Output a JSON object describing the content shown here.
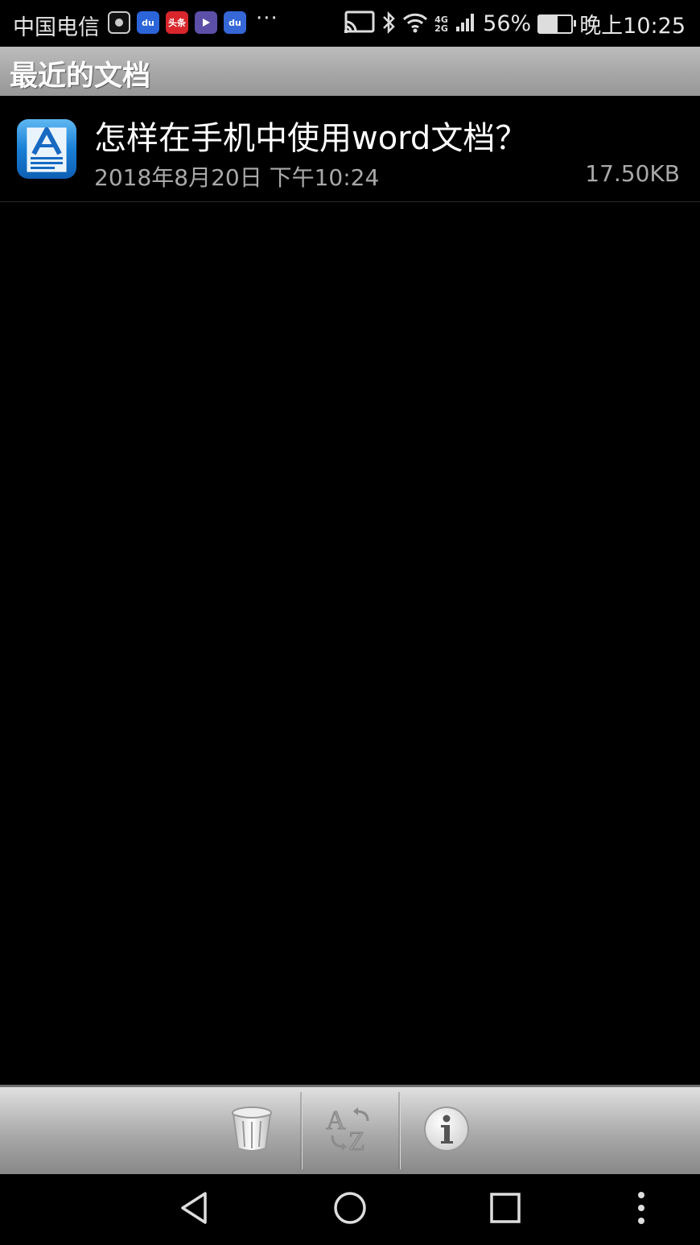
{
  "status_bar": {
    "carrier": "中国电信",
    "apps": [
      {
        "icon": "camera-app-icon",
        "color": "#444"
      },
      {
        "icon": "baidu-app-icon",
        "color": "#2b65d9",
        "text": "du"
      },
      {
        "icon": "toutiao-app-icon",
        "color": "#d8262c",
        "text": "头条"
      },
      {
        "icon": "video-app-icon",
        "color": "#5b4fa8"
      },
      {
        "icon": "baidu-map-app-icon",
        "color": "#3567d6",
        "text": "du"
      }
    ],
    "more": "···",
    "network": "4G 2G",
    "battery": "56%",
    "battery_level": 0.56,
    "time": "晚上10:25"
  },
  "title": "最近的文档",
  "documents": [
    {
      "title": "怎样在手机中使用word文档？",
      "date": "2018年8月20日 下午10:24",
      "size": "17.50KB",
      "icon": "document-app-icon"
    }
  ],
  "toolbar": {
    "buttons": [
      {
        "name": "delete-button",
        "icon": "trash-icon"
      },
      {
        "name": "sort-button",
        "icon": "sort-az-icon"
      },
      {
        "name": "info-button",
        "icon": "info-icon"
      }
    ]
  },
  "nav": {
    "back": "back-icon",
    "home": "home-icon",
    "recents": "recents-icon",
    "menu": "menu-icon"
  }
}
